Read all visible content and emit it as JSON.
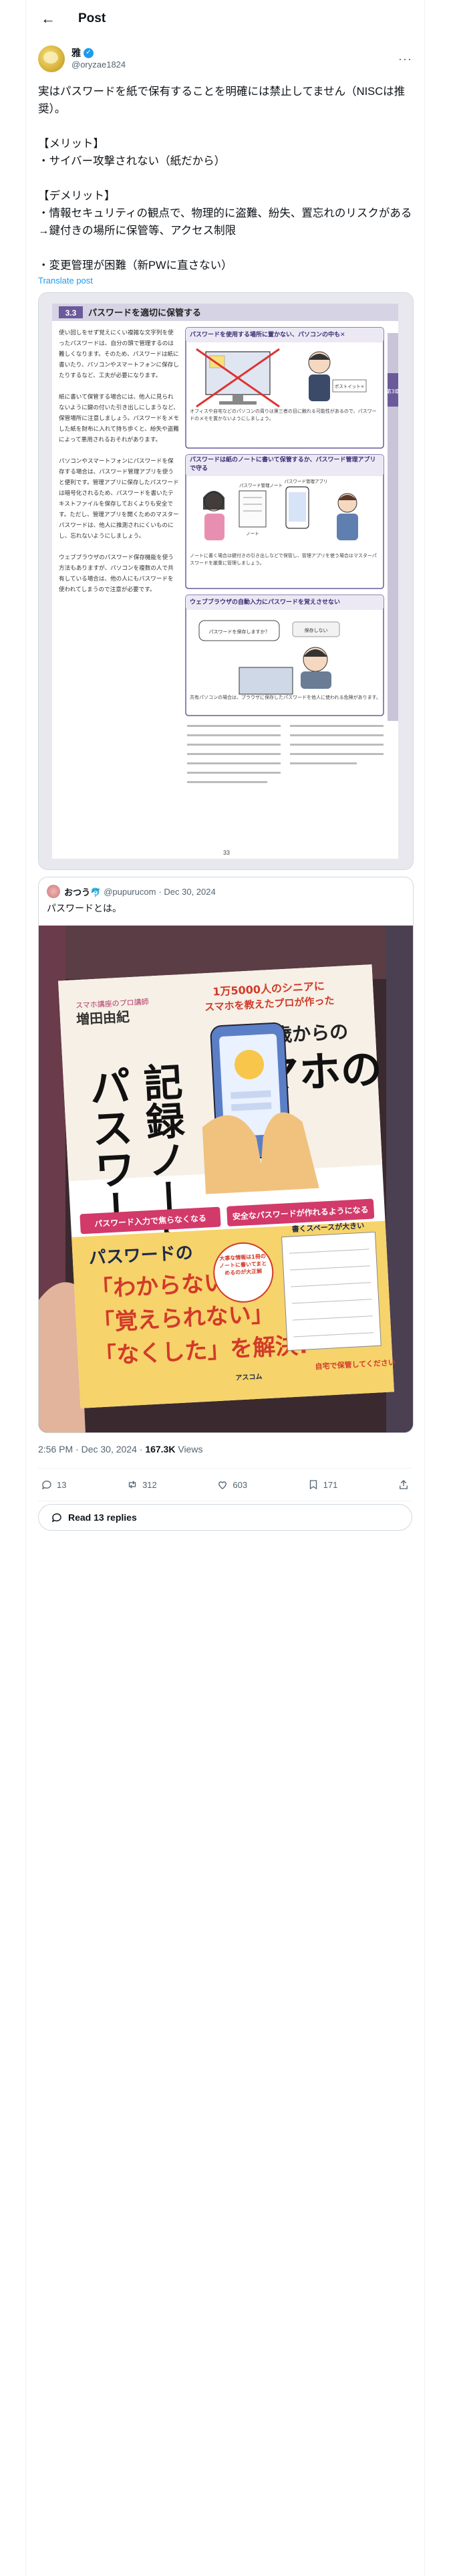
{
  "topbar": {
    "title": "Post"
  },
  "author": {
    "name": "雅",
    "handle": "@oryzae1824"
  },
  "tweet": {
    "text": "実はパスワードを紙で保有することを明確には禁止してません（NISCは推奨）。\n\n【メリット】\n・サイバー攻撃されない（紙だから）\n\n【デメリット】\n・情報セキュリティの観点で、物理的に盗難、紛失、置忘れのリスクがある\n→鍵付きの場所に保管等、アクセス制限\n\n・変更管理が困難（新PWに直さない）",
    "translate": "Translate post"
  },
  "doc": {
    "section_num": "3.3",
    "section_title": "パスワードを適切に保管する",
    "body": "使い回しをせず覚えにくい複雑な文字列を使ったパスワードは、自分の頭で管理するのは難しくなります。そのため、パスワードは紙に書いたり、パソコンやスマートフォンに保存したりするなど、工夫が必要になります。\n\n紙に書いて保管する場合には、他人に見られないように鍵の付いた引き出しにしまうなど、保管場所に注意しましょう。パスワードをメモした紙を財布に入れて持ち歩くと、紛失や盗難によって悪用されるおそれがあります。\n\nパソコンやスマートフォンにパスワードを保存する場合は、パスワード管理アプリを使うと便利です。管理アプリに保存したパスワードは暗号化されるため、パスワードを書いたテキストファイルを保存しておくよりも安全です。ただし、管理アプリを開くためのマスターパスワードは、他人に推測されにくいものにし、忘れないようにしましょう。\n\nウェブブラウザのパスワード保存機能を使う方法もありますが、パソコンを複数の人で共有している場合は、他の人にもパスワードを使われてしまうので注意が必要です。",
    "box1_title": "パスワードを使用する場所に置かない、パソコンの中も✕",
    "box1_caption1": "パスワードを書いた紙をパソコンのモニターに貼らない",
    "box1_caption2": "ポストイット×",
    "box1_caption3": "オフィスや自宅などのパソコンの周りは第三者の目に触れる可能性があるので、パスワードのメモを置かないようにしましょう。",
    "box2_title": "パスワードは紙のノートに書いて保管するか、パスワード管理アプリで守る",
    "box2_label1": "パスワード管理ノート",
    "box2_label2": "ノート",
    "box2_label3": "パスワード管理アプリ",
    "box2_caption": "ノートに書く場合は鍵付きの引き出しなどで保管し、管理アプリを使う場合はマスターパスワードを厳重に管理しましょう。",
    "box3_title": "ウェブブラウザの自動入力にパスワードを覚えさせない",
    "box3_bubble1": "パスワードを保存しますか？",
    "box3_bubble2": "保存しない",
    "box3_caption": "共有パソコンの場合は、ブラウザに保存したパスワードを他人に使われる危険があります。",
    "side_tab": "第3章",
    "page": "33"
  },
  "quote": {
    "name": "おつう🐬",
    "handle": "@pupurucom",
    "date": "· Dec 30, 2024",
    "text": "パスワードとは。"
  },
  "book": {
    "author_role": "スマホ講座のプロ講師",
    "author": "増田由紀",
    "tagline1": "1万5000人のシニアに",
    "tagline2": "スマホを教えたプロが作った",
    "age": "70歳からの",
    "title1": "スマホの",
    "title2": "パスワード",
    "title3": "記録ノート",
    "ribbon1": "パスワード入力で焦らなくなる",
    "ribbon2": "安全なパスワードが作れるようになる",
    "ribbon3": "書くスペースが大きい",
    "headline": "パスワードの",
    "pill1": "「わからない」",
    "pill2": "「覚えられない」",
    "pill3": "「なくした」を解決!",
    "sticker": "大事な情報は1冊のノートに書いてまとめるのが大正解",
    "feature": "自宅で保管してください",
    "publisher": "アスコム"
  },
  "meta": {
    "time": "2:56 PM · Dec 30, 2024 · ",
    "views": "167.3K",
    "views_label": " Views"
  },
  "actions": {
    "replies": "13",
    "reposts": "312",
    "likes": "603",
    "bookmarks": "171"
  },
  "read_replies": "Read 13 replies"
}
